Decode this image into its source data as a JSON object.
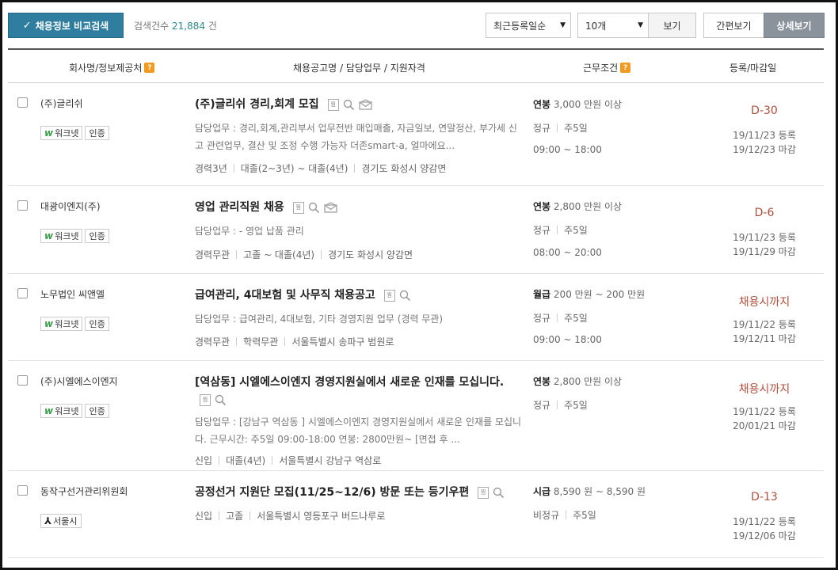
{
  "toolbar": {
    "compare_button": "채용정보 비교검색",
    "count_label": "검색건수",
    "count_value": "21,884",
    "count_unit": "건",
    "sort_selected": "최근등록일순",
    "size_selected": "10개",
    "view_button": "보기",
    "simple_view": "간편보기",
    "detail_view": "상세보기"
  },
  "header": {
    "company_col": "회사명/정보제공처",
    "title_col": "채용공고명 / 담당업무 / 지원자격",
    "cond_col": "근무조건",
    "date_col": "등록/마감일"
  },
  "icons": {
    "doc": "찜"
  },
  "rows": [
    {
      "company": "(주)글리쉬",
      "badge_source": "워크넷",
      "badge_cert": "인증",
      "title": "(주)글리쉬 경리,회계 모집",
      "duty": "담당업무 : 경리,회계,관리부서 업무전반 매입매출, 자금일보, 연말정산, 부가세 신고 관련업무, 결산 및 조정 수행 가능자 더존smart-a, 얼마에요...",
      "meta": [
        "경력3년",
        "대졸(2~3년) ~ 대졸(4년)",
        "경기도 화성시 양감면"
      ],
      "salary_type": "연봉",
      "salary": "3,000 만원 이상",
      "work": [
        "정규",
        "주5일"
      ],
      "hours": "09:00 ~ 18:00",
      "dday": "D-30",
      "reg": "19/11/23 등록",
      "close": "19/12/23 마감"
    },
    {
      "company": "대광이엔지(주)",
      "badge_source": "워크넷",
      "badge_cert": "인증",
      "title": "영업 관리직원 채용",
      "duty": "담당업무 : - 영업 납품 관리",
      "meta": [
        "경력무관",
        "고졸 ~ 대졸(4년)",
        "경기도 화성시 양감면"
      ],
      "salary_type": "연봉",
      "salary": "2,800 만원 이상",
      "work": [
        "정규",
        "주5일"
      ],
      "hours": "08:00 ~ 20:00",
      "dday": "D-6",
      "reg": "19/11/23 등록",
      "close": "19/11/29 마감"
    },
    {
      "company": "노무법인 씨앤엘",
      "badge_source": "워크넷",
      "badge_cert": "인증",
      "title": "급여관리, 4대보험 및 사무직 채용공고",
      "duty": "담당업무 : 급여관리, 4대보험, 기타 경영지원 업무 (경력 무관)",
      "meta": [
        "경력무관",
        "학력무관",
        "서울특별시 송파구 범원로"
      ],
      "salary_type": "월급",
      "salary": "200 만원 ~ 200 만원",
      "work": [
        "정규",
        "주5일"
      ],
      "hours": "09:00 ~ 18:00",
      "dday": "채용시까지",
      "reg": "19/11/22 등록",
      "close": "19/12/11 마감"
    },
    {
      "company": "(주)시엘에스이엔지",
      "badge_source": "워크넷",
      "badge_cert": "인증",
      "title": "[역삼동] 시엘에스이엔지 경영지원실에서 새로운 인재를 모십니다.",
      "duty": "담당업무 : [강남구 역삼동 ] 시엘에스이엔지 경영지원실에서 새로운 인재를 모십니다. 근무시간: 주5일 09:00-18:00 연봉: 2800만원~ [면접 후 ...",
      "meta": [
        "신입",
        "대졸(4년)",
        "서울특별시 강남구 역삼로"
      ],
      "salary_type": "연봉",
      "salary": "2,800 만원 이상",
      "work": [
        "정규",
        "주5일"
      ],
      "hours": "",
      "dday": "채용시까지",
      "reg": "19/11/22 등록",
      "close": "20/01/21 마감"
    },
    {
      "company": "동작구선거관리위원회",
      "badge_source": "서울시",
      "badge_cert": "",
      "title": "공정선거 지원단 모집(11/25~12/6) 방문 또는 등기우편",
      "duty": "",
      "meta": [
        "신입",
        "고졸",
        "서울특별시 영등포구 버드나루로"
      ],
      "salary_type": "시급",
      "salary": "8,590 원 ~ 8,590 원",
      "work": [
        "비정규",
        "주5일"
      ],
      "hours": "",
      "dday": "D-13",
      "reg": "19/11/22 등록",
      "close": "19/12/06 마감"
    }
  ]
}
